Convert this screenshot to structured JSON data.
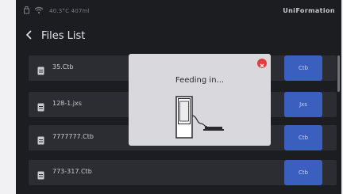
{
  "status": {
    "text": "40.3°C 407ml"
  },
  "brand": "UniFormation",
  "header": {
    "title": "Files List"
  },
  "files": [
    {
      "name": "35.Ctb",
      "type": "Ctb"
    },
    {
      "name": "128-1.jxs",
      "type": "Jxs"
    },
    {
      "name": "7777777.Ctb",
      "type": "Ctb"
    },
    {
      "name": "773-317.Ctb",
      "type": "Ctb"
    }
  ],
  "modal": {
    "message": "Feeding in..."
  },
  "colors": {
    "accent": "#3a5fbf",
    "close": "#e23c3c"
  },
  "icons": [
    "usb-icon",
    "wifi-icon",
    "back-arrow-icon",
    "file-icon",
    "close-icon",
    "feeding-illustration-icon"
  ]
}
